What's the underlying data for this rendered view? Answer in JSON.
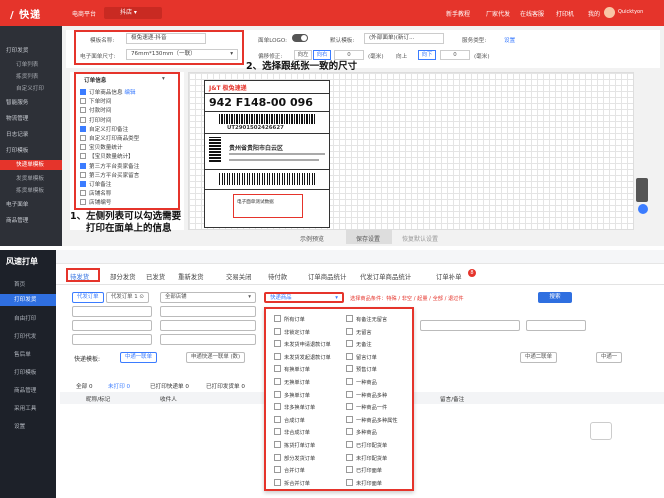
{
  "top": {
    "logo": "/ 快递",
    "nav": [
      "电商平台",
      "抖店"
    ],
    "right": [
      "新手教程",
      "厂家代发",
      "在线客服",
      "打印机",
      "我的",
      "Quicktyon"
    ],
    "sidebar": [
      "打印发货",
      "订单列表",
      "拣货列表",
      "自定义打印",
      "智能服务",
      "物流管理",
      "日志记录",
      "打印模板",
      "快递单模板",
      "发货单模板",
      "拣货单模板",
      "电子面单",
      "商品管理"
    ],
    "form": {
      "template_name_label": "模板名称:",
      "template_name": "极兔速递-抖音",
      "paper_label": "电子面单尺寸:",
      "paper": "76mm*130mm（一联）",
      "logo_label": "面单LOGO:",
      "default_label": "默认模板:",
      "default_value": "(外部面单)(新订...",
      "service_label": "服务类型:",
      "service_value": "设置",
      "offset_label": "偏移修正:",
      "offset_values": [
        "向左",
        "向右",
        "0",
        "(毫米)",
        "向上",
        "向下",
        "0",
        "(毫米)"
      ]
    },
    "annotation_right": "2、选择跟纸张一致的尺寸",
    "annotation_left_1": "1、左侧列表可以勾选需要",
    "annotation_left_2": "打印在面单上的信息",
    "fields_header": "订单信息",
    "fields": [
      {
        "label": "订单商品信息",
        "checked": true,
        "extra": "编辑"
      },
      {
        "label": "下单时间",
        "checked": false
      },
      {
        "label": "付款时间",
        "checked": false
      },
      {
        "label": "打印时间",
        "checked": false
      },
      {
        "label": "自定义打印备注",
        "checked": true
      },
      {
        "label": "自定义打印商品类型",
        "checked": false
      },
      {
        "label": "宝贝数量统计",
        "checked": false
      },
      {
        "label": "【宝贝数量统计】",
        "checked": false
      },
      {
        "label": "第三方平台卖家备注",
        "checked": true
      },
      {
        "label": "第三方平台买家留言",
        "checked": false
      },
      {
        "label": "订单备注",
        "checked": true
      },
      {
        "label": "店铺名称",
        "checked": false
      },
      {
        "label": "店铺编号",
        "checked": false
      }
    ],
    "waybill": {
      "brand": "J&T 极兔速递",
      "code": "942 F148-00 096",
      "number": "UT2901502426627",
      "dest": "贵州省贵阳市白云区",
      "note": "电子面单测试数据"
    },
    "buttons": [
      "示例预览",
      "保存设置",
      "恢复默认设置"
    ]
  },
  "bottom": {
    "logo": "风速打单",
    "sidebar": [
      "首页",
      "打印发货",
      "自由打印",
      "打印代发",
      "售后单",
      "打印模板",
      "商品管理",
      "采用工具",
      "设置"
    ],
    "tabs": [
      "待发货",
      "部分发货",
      "已发货",
      "重新发货",
      "交易关闭",
      "待付款",
      "订单商品统计",
      "代发订单商品统计",
      "订单补单"
    ],
    "filters": [
      "代发订单",
      "代发订单 1 ⊙",
      "全部店铺",
      "快递商品"
    ],
    "search_button": "搜索",
    "highlight_hint": "选择商品条件：特殊 / 非空 / 起量 / 全部 / 退过件",
    "rows": [
      "快递模板:",
      "中通一联单",
      "申通快递一联单 (数)",
      "中通二联单",
      "中通一"
    ],
    "columns": [
      "全部 0",
      "未打印 0",
      "已打印快递单 0",
      "已打印发货单 0"
    ],
    "table_headers": [
      "昵称/标记",
      "收件人",
      "留言/备注"
    ],
    "dropdown": [
      [
        "所有订单",
        "有备注无留言"
      ],
      [
        "非锁定订单",
        "无留言"
      ],
      [
        "未发货申请退款订单",
        "无备注"
      ],
      [
        "未发货发起退款订单",
        "留言订单"
      ],
      [
        "有换单订单",
        "预售订单"
      ],
      [
        "无换单订单",
        "一种商品"
      ],
      [
        "多换单订单",
        "一种商品多种"
      ],
      [
        "非多换单订单",
        "一种商品一件"
      ],
      [
        "合成订单",
        "一种商品多种属性"
      ],
      [
        "非合成订单",
        "多种商品"
      ],
      [
        "拣货打单订单",
        "已打印配货单"
      ],
      [
        "部分发货订单",
        "未打印配货单"
      ],
      [
        "合并订单",
        "已打印面单"
      ],
      [
        "拆合并订单",
        "未打印面单"
      ]
    ]
  }
}
